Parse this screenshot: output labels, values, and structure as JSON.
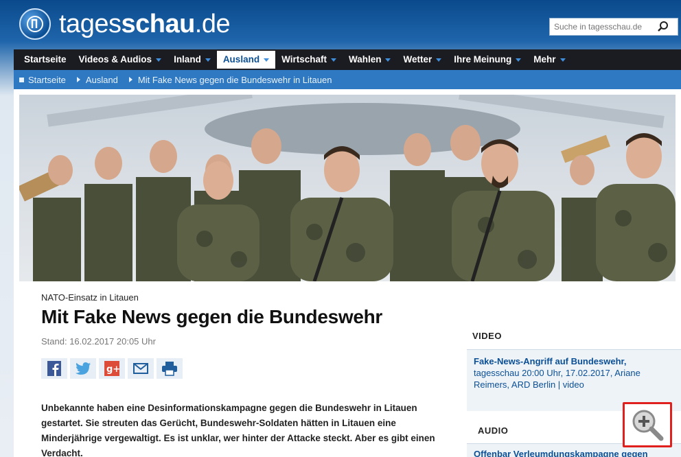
{
  "header": {
    "site_name_prefix": "tages",
    "site_name_bold": "schau",
    "site_name_suffix": ".de",
    "search_placeholder": "Suche in tagesschau.de"
  },
  "nav": {
    "items": [
      {
        "label": "Startseite"
      },
      {
        "label": "Videos & Audios"
      },
      {
        "label": "Inland"
      },
      {
        "label": "Ausland"
      },
      {
        "label": "Wirtschaft"
      },
      {
        "label": "Wahlen"
      },
      {
        "label": "Wetter"
      },
      {
        "label": "Ihre Meinung"
      },
      {
        "label": "Mehr"
      }
    ],
    "active": "Ausland"
  },
  "breadcrumb": [
    "Startseite",
    "Ausland",
    "Mit Fake News gegen die Bundeswehr in Litauen"
  ],
  "article": {
    "kicker": "NATO-Einsatz in Litauen",
    "title": "Mit Fake News gegen die Bundeswehr",
    "stand": "Stand: 16.02.2017 20:05 Uhr",
    "lead": "Unbekannte haben eine Desinformationskampagne gegen die Bundeswehr in Litauen gestartet. Sie streuten das Gerücht, Bundeswehr-Soldaten hätten in Litauen eine Minderjährige vergewaltigt. Es ist unklar, wer hinter der Attacke steckt. Aber es gibt einen Verdacht.",
    "share_icons": [
      "facebook-icon",
      "twitter-icon",
      "google-plus-icon",
      "mail-icon",
      "print-icon"
    ]
  },
  "sidebar": {
    "video_heading": "VIDEO",
    "video_title": "Fake-News-Angriff auf Bundeswehr,",
    "video_meta": "tagesschau 20:00 Uhr, 17.02.2017, Ariane Reimers, ARD Berlin | video",
    "audio_heading": "AUDIO",
    "audio_title": "Offenbar Verleumdungskampagne gegen"
  },
  "colors": {
    "brand_blue": "#0b4f95",
    "nav_bg": "#1b1b22",
    "breadcrumb_bg": "#2f79c3",
    "highlight_red": "#e0201d"
  },
  "icons": {
    "search": "search-icon",
    "zoom": "zoom-in-icon",
    "logo": "tagesschau-globe-icon"
  }
}
